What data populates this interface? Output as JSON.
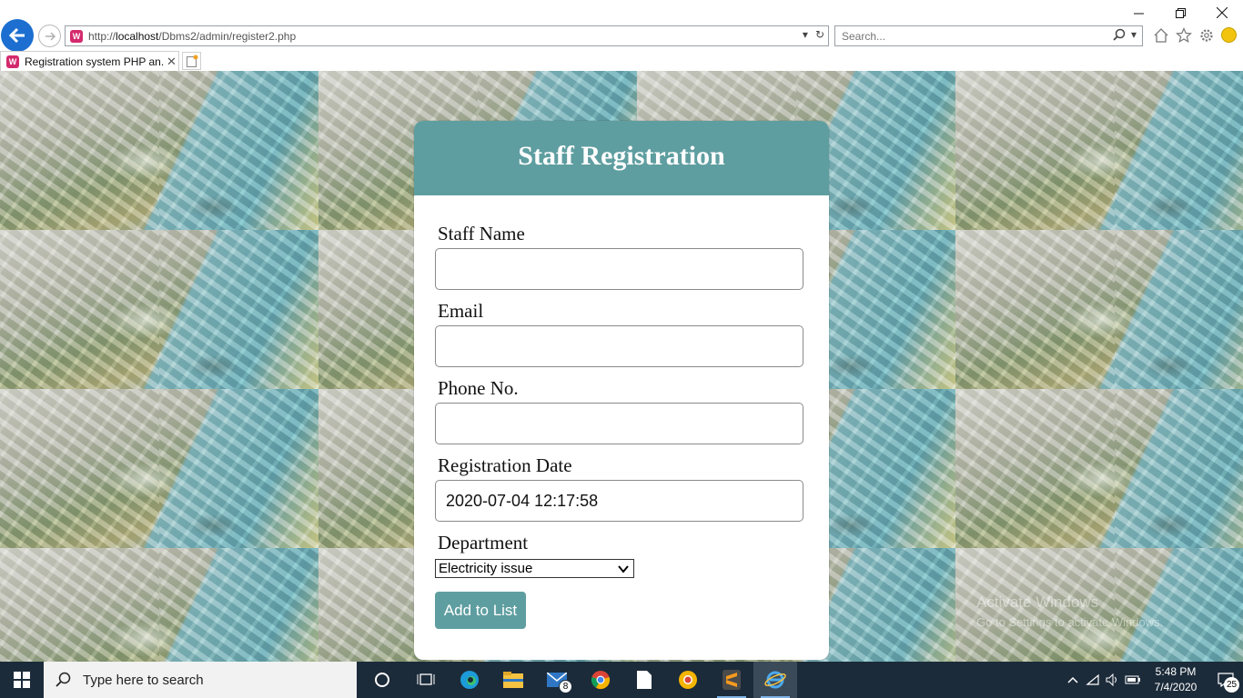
{
  "browser": {
    "url_prefix": "http://",
    "url_host": "localhost",
    "url_path": "/Dbms2/admin/register2.php",
    "search_placeholder": "Search...",
    "tab_title": "Registration system PHP an...",
    "site_icon_letter": "W"
  },
  "form": {
    "title": "Staff Registration",
    "staff_name_label": "Staff Name",
    "staff_name_value": "",
    "email_label": "Email",
    "email_value": "",
    "phone_label": "Phone No.",
    "phone_value": "",
    "reg_date_label": "Registration Date",
    "reg_date_value": "2020-07-04 12:17:58",
    "department_label": "Department",
    "department_selected": "Electricity issue",
    "submit_label": "Add to List"
  },
  "watermark": {
    "line1": "Activate Windows",
    "line2": "Go to Settings to activate Windows."
  },
  "taskbar": {
    "search_text": "Type here to search",
    "mail_badge": "8",
    "time": "5:48 PM",
    "date": "7/4/2020",
    "notification_count": "25"
  },
  "colors": {
    "accent": "#5f9ea0",
    "back_button": "#1c6fd0",
    "taskbar": "#1c2b3a"
  }
}
